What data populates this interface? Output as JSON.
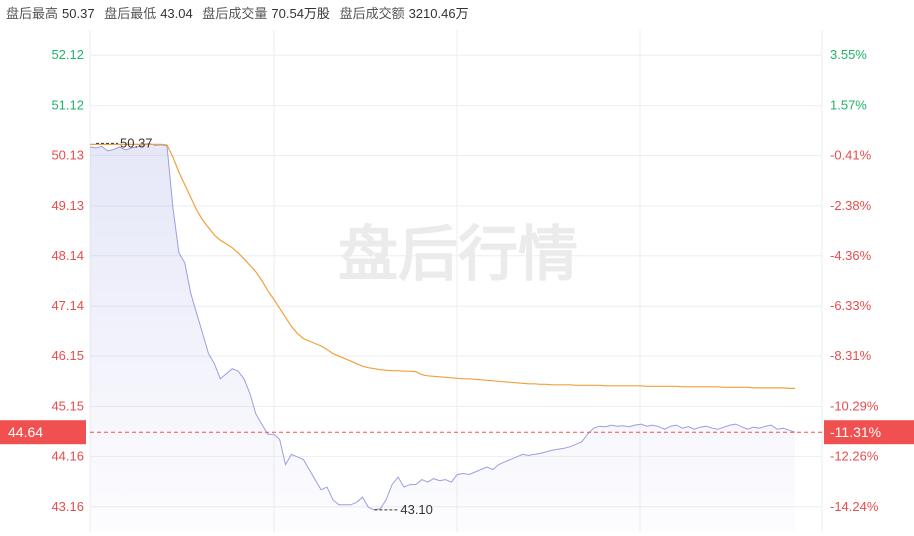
{
  "header": {
    "stats": [
      {
        "label": "盘后最高",
        "value": "50.37"
      },
      {
        "label": "盘后最低",
        "value": "43.04"
      },
      {
        "label": "盘后成交量",
        "value": "70.54万股"
      },
      {
        "label": "盘后成交额",
        "value": "3210.46万"
      }
    ]
  },
  "watermark": "盘后行情",
  "colors": {
    "up": "#e84d4d",
    "down": "#20b26a",
    "price_line": "#9a9ee0",
    "avg_line": "#f0a040",
    "grid": "#eeeeee",
    "current_bg": "#f05050"
  },
  "chart_data": {
    "type": "line",
    "title": "",
    "ylim": [
      42.66,
      52.62
    ],
    "y_ticks_left": [
      "52.12",
      "51.12",
      "50.13",
      "49.13",
      "48.14",
      "47.14",
      "46.15",
      "45.15",
      "44.16",
      "43.16"
    ],
    "y_ticks_left_values": [
      52.12,
      51.12,
      50.13,
      49.13,
      48.14,
      47.14,
      46.15,
      45.15,
      44.16,
      43.16
    ],
    "y_ticks_right": [
      "3.55%",
      "1.57%",
      "-0.41%",
      "-2.38%",
      "-4.36%",
      "-6.33%",
      "-8.31%",
      "-10.29%",
      "-12.26%",
      "-14.24%"
    ],
    "current_price": "44.64",
    "current_change": "-11.31%",
    "high_annotation": "50.37",
    "low_annotation": "43.10",
    "n_points": 120,
    "series": [
      {
        "values": [
          50.3,
          50.28,
          50.31,
          50.22,
          50.25,
          50.3,
          50.24,
          50.28,
          50.3,
          50.35,
          50.37,
          50.33,
          50.34,
          50.32,
          49.1,
          48.2,
          48.0,
          47.4,
          47.0,
          46.6,
          46.2,
          46.0,
          45.7,
          45.8,
          45.9,
          45.85,
          45.7,
          45.4,
          45.0,
          44.8,
          44.6,
          44.6,
          44.5,
          44.0,
          44.2,
          44.15,
          44.1,
          43.9,
          43.7,
          43.5,
          43.55,
          43.3,
          43.2,
          43.2,
          43.2,
          43.25,
          43.35,
          43.15,
          43.1,
          43.12,
          43.3,
          43.6,
          43.75,
          43.55,
          43.6,
          43.6,
          43.7,
          43.65,
          43.72,
          43.68,
          43.7,
          43.65,
          43.8,
          43.82,
          43.8,
          43.85,
          43.9,
          43.95,
          43.9,
          44.0,
          44.05,
          44.1,
          44.15,
          44.2,
          44.18,
          44.2,
          44.22,
          44.25,
          44.28,
          44.3,
          44.32,
          44.35,
          44.4,
          44.45,
          44.6,
          44.72,
          44.76,
          44.75,
          44.78,
          44.76,
          44.77,
          44.75,
          44.78,
          44.8,
          44.76,
          44.78,
          44.75,
          44.7,
          44.76,
          44.78,
          44.72,
          44.75,
          44.7,
          44.74,
          44.76,
          44.72,
          44.7,
          44.74,
          44.78,
          44.8,
          44.75,
          44.7,
          44.74,
          44.72,
          44.76,
          44.78,
          44.7,
          44.72,
          44.68,
          44.64
        ]
      },
      {
        "values": [
          50.35,
          50.35,
          50.35,
          50.35,
          50.35,
          50.35,
          50.35,
          50.35,
          50.35,
          50.35,
          50.35,
          50.35,
          50.35,
          50.34,
          50.1,
          49.8,
          49.55,
          49.3,
          49.05,
          48.85,
          48.7,
          48.55,
          48.45,
          48.38,
          48.3,
          48.2,
          48.08,
          47.95,
          47.82,
          47.65,
          47.45,
          47.28,
          47.1,
          46.92,
          46.74,
          46.6,
          46.5,
          46.45,
          46.4,
          46.35,
          46.28,
          46.2,
          46.15,
          46.1,
          46.05,
          46.0,
          45.95,
          45.92,
          45.9,
          45.88,
          45.87,
          45.86,
          45.86,
          45.85,
          45.85,
          45.84,
          45.78,
          45.76,
          45.75,
          45.74,
          45.73,
          45.72,
          45.71,
          45.7,
          45.7,
          45.69,
          45.68,
          45.67,
          45.66,
          45.65,
          45.64,
          45.63,
          45.62,
          45.61,
          45.6,
          45.6,
          45.59,
          45.59,
          45.58,
          45.58,
          45.58,
          45.58,
          45.57,
          45.57,
          45.57,
          45.57,
          45.57,
          45.56,
          45.56,
          45.56,
          45.56,
          45.56,
          45.56,
          45.56,
          45.55,
          45.55,
          45.55,
          45.55,
          45.55,
          45.55,
          45.54,
          45.54,
          45.54,
          45.54,
          45.54,
          45.54,
          45.54,
          45.53,
          45.53,
          45.53,
          45.53,
          45.53,
          45.52,
          45.52,
          45.52,
          45.52,
          45.52,
          45.52,
          45.51,
          45.51
        ]
      }
    ]
  }
}
